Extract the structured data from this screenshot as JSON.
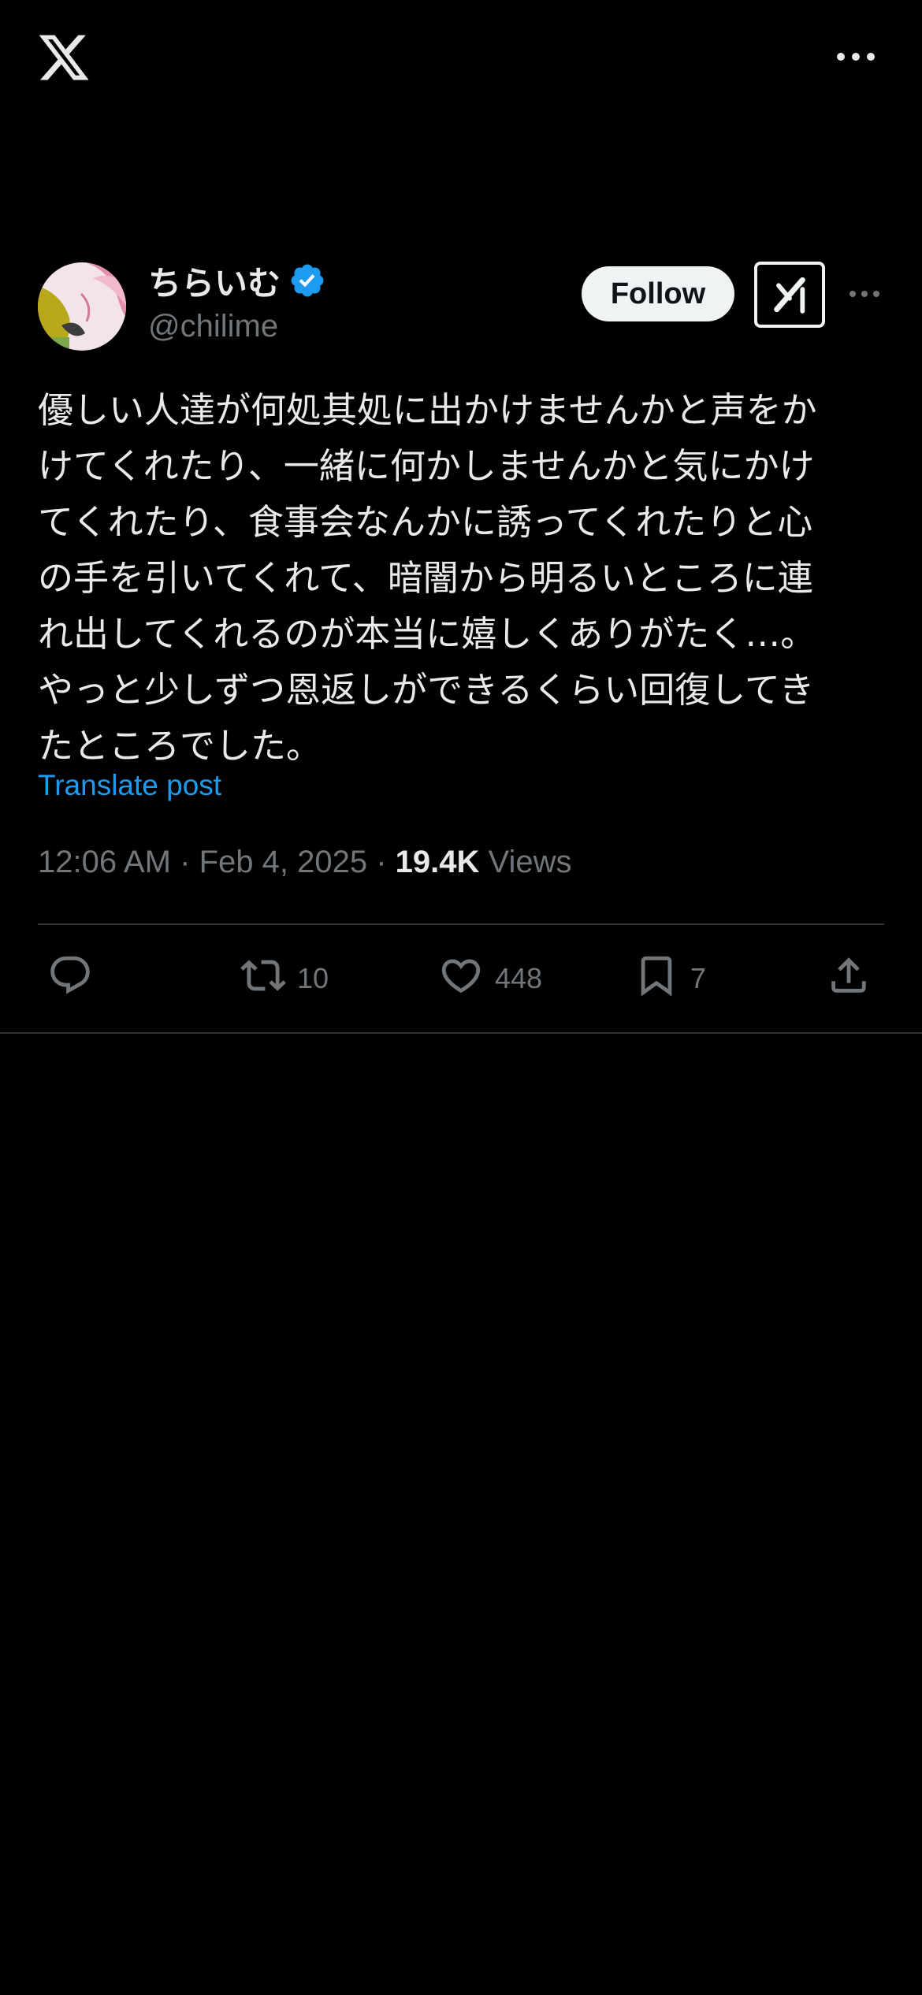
{
  "top_bar": {
    "logo_icon": "x-logo-icon",
    "more_icon": "more-horizontal-icon"
  },
  "author": {
    "display_name": "ちらいむ",
    "handle": "@chilime",
    "verified": true,
    "verified_color": "#1d9bf0"
  },
  "header": {
    "follow_label": "Follow",
    "grok_icon": "grok-icon",
    "more_icon": "more-horizontal-icon"
  },
  "post": {
    "text": "優しい人達が何処其処に出かけませんかと声をか\nけてくれたり、一緒に何かしませんかと気にかけ\nてくれたり、食事会なんかに誘ってくれたりと心\nの手を引いてくれて、暗闇から明るいところに連\nれ出してくれるのが本当に嬉しくありがたく…。\nやっと少しずつ恩返しができるくらい回復してき\nたところでした。",
    "translate_label": "Translate post",
    "time": "12:06 AM",
    "date": "Feb 4, 2025",
    "views_count": "19.4K",
    "views_label": "Views"
  },
  "actions": {
    "reply_count": "",
    "repost_count": "10",
    "like_count": "448",
    "bookmark_count": "7"
  },
  "colors": {
    "background": "#000000",
    "text": "#e7e9ea",
    "muted": "#71767b",
    "accent": "#1d9bf0"
  }
}
